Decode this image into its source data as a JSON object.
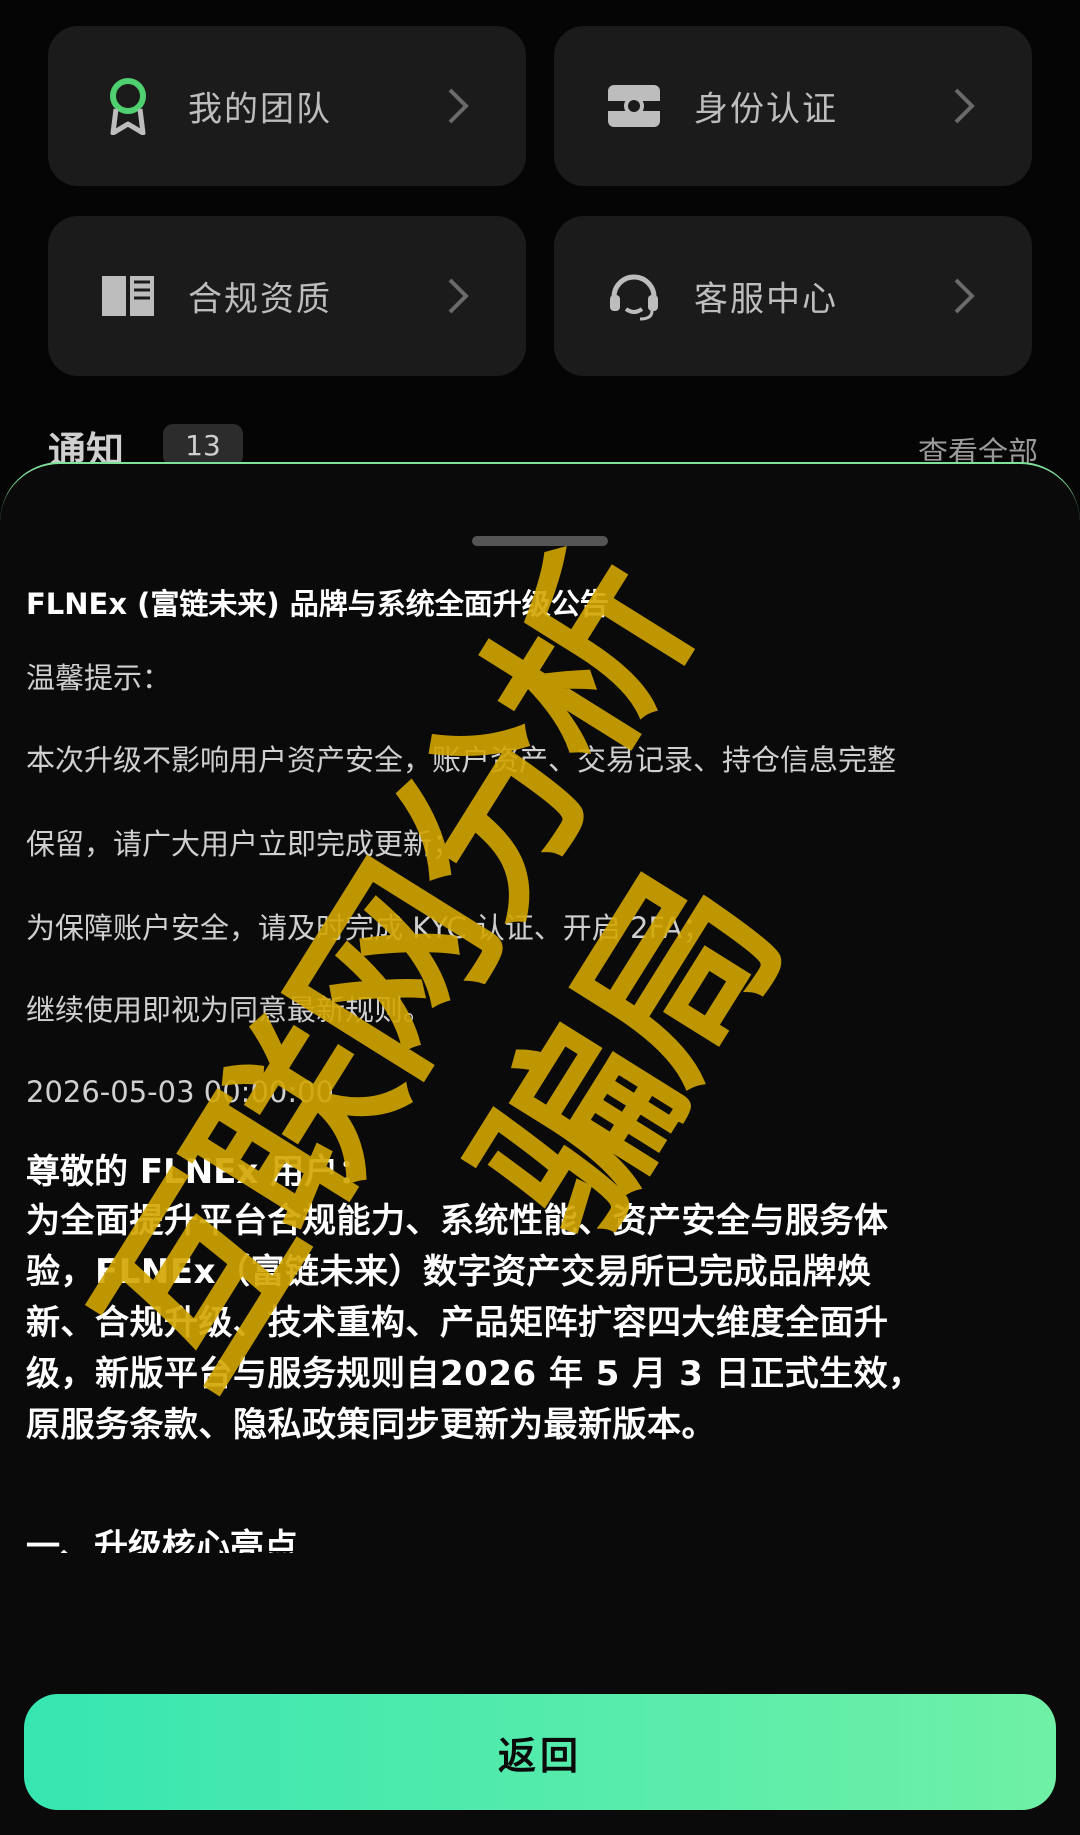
{
  "menu": [
    {
      "label": "我的团队",
      "icon": "ribbon-award-icon"
    },
    {
      "label": "身份认证",
      "icon": "id-card-icon"
    },
    {
      "label": "合规资质",
      "icon": "book-icon"
    },
    {
      "label": "客服中心",
      "icon": "headset-icon"
    }
  ],
  "notice": {
    "title": "通知",
    "count": "13",
    "view_all": "查看全部"
  },
  "sheet": {
    "title": "FLNEx (富链未来) 品牌与系统全面升级公告",
    "tips": [
      "温馨提示：",
      "本次升级不影响用户资产安全，账户资产、交易记录、持仓信息完整",
      "保留，请广大用户立即完成更新；",
      "为保障账户安全，请及时完成 KYC 认证、开启 2FA；",
      "继续使用即视为同意最新规则。"
    ],
    "date": "2026-05-03 00:00:00",
    "greeting": "尊敬的 FLNEx 用户：",
    "body": [
      "为全面提升平台合规能力、系统性能、资产安全与服务体",
      "验，FLNEx（富链未来）数字资产交易所已完成品牌焕",
      "新、合规升级、技术重构、产品矩阵扩容四大维度全面升",
      "级，新版平台与服务规则自2026 年 5 月 3 日正式生效，",
      "原服务条款、隐私政策同步更新为最新版本。"
    ],
    "section": "一、升级核心亮点"
  },
  "back_button": "返回",
  "watermark": {
    "line1": "互联网分析",
    "line2": "骗局",
    "color": "#d2a500"
  },
  "colors": {
    "accent": "#6ff0a6",
    "accent_start": "#37e6b1"
  }
}
